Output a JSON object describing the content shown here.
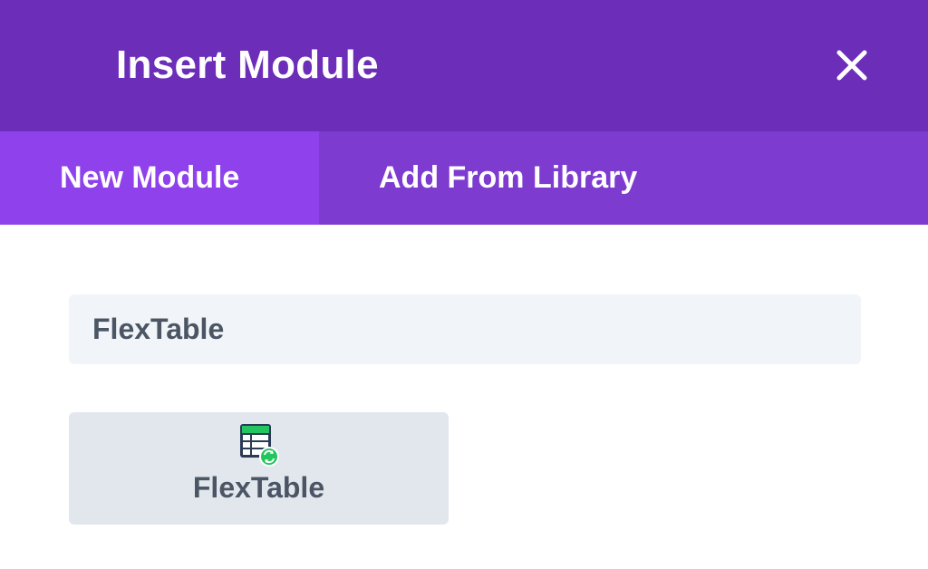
{
  "header": {
    "title": "Insert Module",
    "close_icon": "close-icon"
  },
  "tabs": [
    {
      "label": "New Module",
      "active": true
    },
    {
      "label": "Add From Library",
      "active": false
    }
  ],
  "search": {
    "value": "FlexTable"
  },
  "modules": [
    {
      "label": "FlexTable",
      "icon": "flextable-icon"
    }
  ],
  "colors": {
    "header_bg": "#6c2eb9",
    "tabs_bg": "#7e3bd0",
    "active_tab_bg": "#8f42ec",
    "icon_green": "#22c55e",
    "icon_navy": "#2b3a55"
  }
}
